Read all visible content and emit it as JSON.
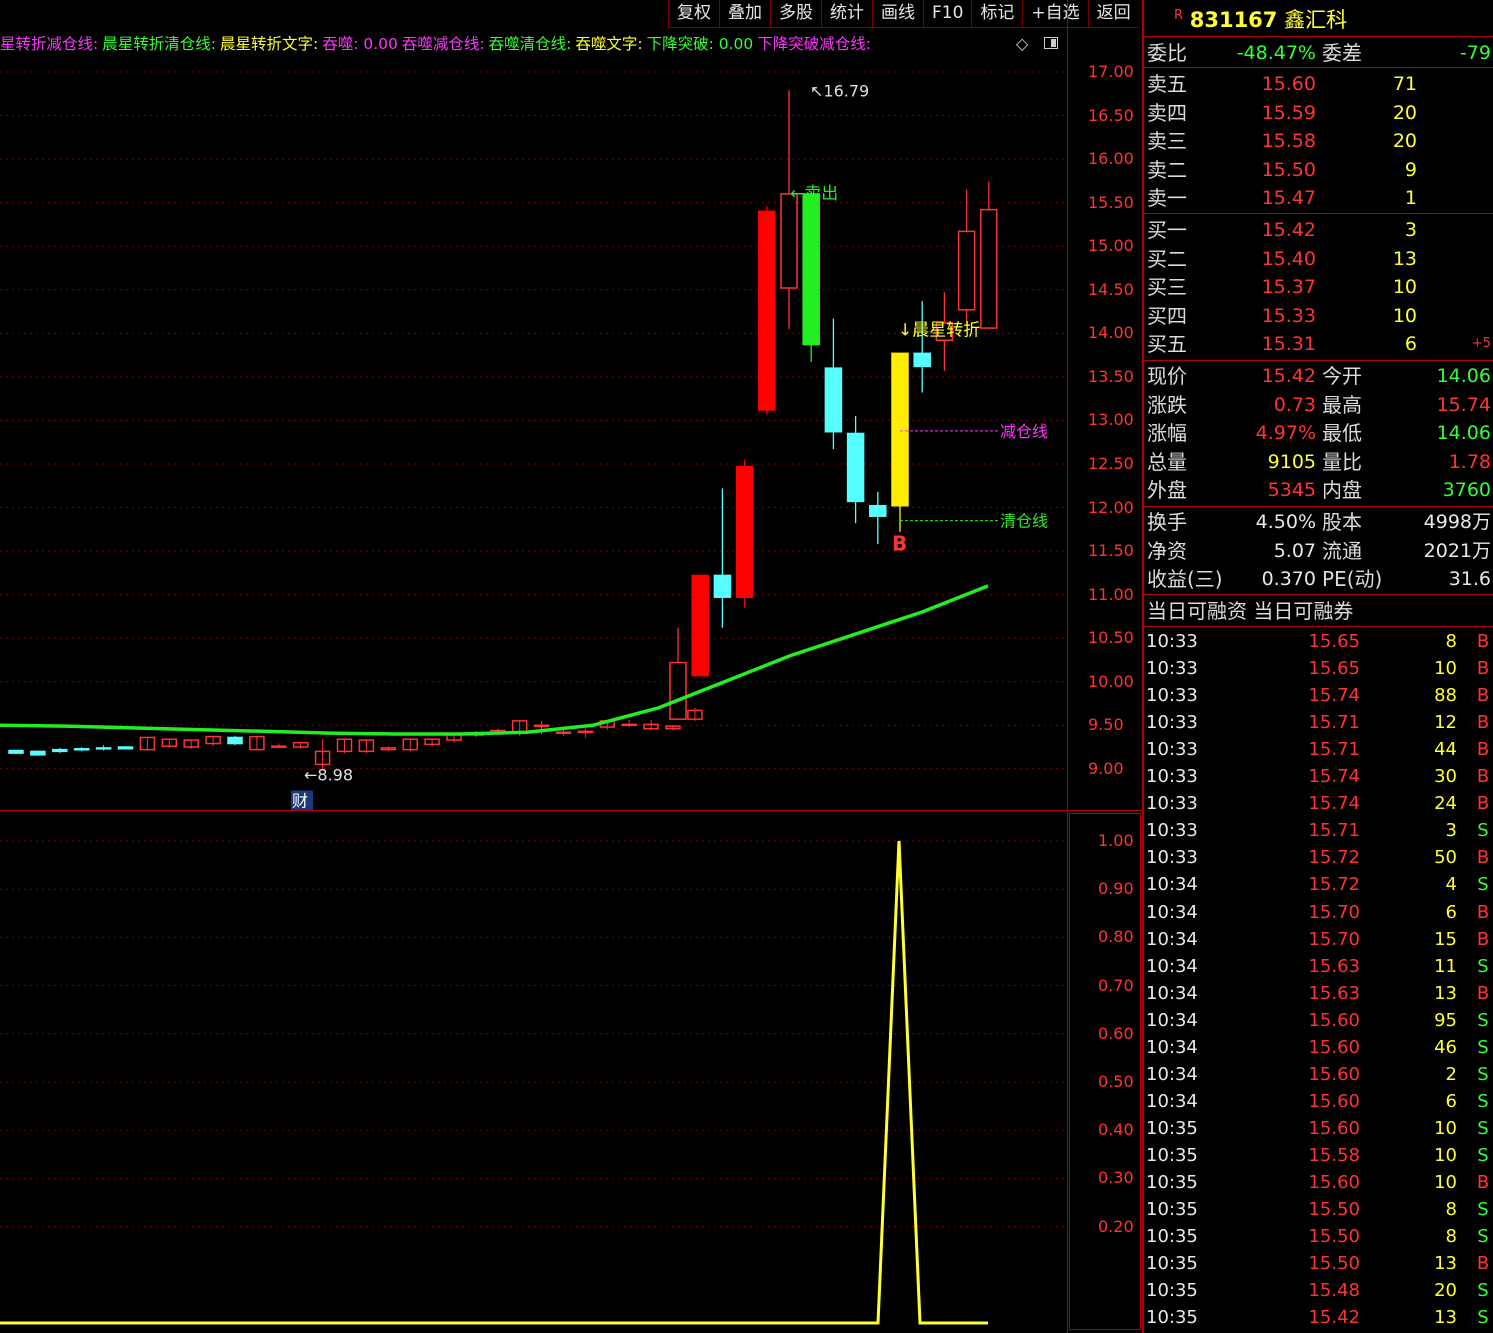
{
  "toolbar": [
    "复权",
    "叠加",
    "多股",
    "统计",
    "画线",
    "F10",
    "标记",
    "+自选",
    "返回"
  ],
  "indicator_line": [
    {
      "text": "星转折减仓线:",
      "color": "mag"
    },
    {
      "text": "晨星转折清仓线:",
      "color": "grn"
    },
    {
      "text": "晨星转折文字:",
      "color": "yel"
    },
    {
      "text": "吞噬: 0.00",
      "color": "mag"
    },
    {
      "text": "吞噬减仓线:",
      "color": "mag"
    },
    {
      "text": "吞噬清仓线:",
      "color": "grn"
    },
    {
      "text": "吞噬文字:",
      "color": "yel"
    },
    {
      "text": "下降突破: 0.00",
      "color": "grn"
    },
    {
      "text": "下降突破减仓线:",
      "color": "mag"
    }
  ],
  "chart_data": [
    {
      "type": "candlestick",
      "y_ticks": [
        17.0,
        16.5,
        16.0,
        15.5,
        15.0,
        14.5,
        14.0,
        13.5,
        13.0,
        12.5,
        12.0,
        11.5,
        11.0,
        10.5,
        10.0,
        9.5,
        9.0
      ],
      "ylim": [
        8.5,
        17.4
      ],
      "flat_candles": [
        [
          9.21,
          9.21,
          9.18,
          9.17
        ],
        [
          9.2,
          9.19,
          9.16,
          9.15
        ],
        [
          9.22,
          9.24,
          9.2,
          9.18
        ],
        [
          9.23,
          9.25,
          9.22,
          9.2
        ],
        [
          9.24,
          9.27,
          9.23,
          9.21
        ],
        [
          9.25,
          9.26,
          9.23,
          9.22
        ],
        [
          9.22,
          9.36,
          9.36,
          9.21
        ],
        [
          9.26,
          9.34,
          9.34,
          9.24
        ],
        [
          9.25,
          9.33,
          9.33,
          9.23
        ],
        [
          9.29,
          9.37,
          9.37,
          9.26
        ],
        [
          9.36,
          9.38,
          9.29,
          9.27
        ],
        [
          9.22,
          9.37,
          9.37,
          9.21
        ],
        [
          9.26,
          9.29,
          9.26,
          9.24
        ],
        [
          9.25,
          9.3,
          9.3,
          9.23
        ],
        [
          9.05,
          9.34,
          9.2,
          8.98
        ],
        [
          9.2,
          9.34,
          9.34,
          9.18
        ],
        [
          9.2,
          9.33,
          9.33,
          9.18
        ],
        [
          9.22,
          9.26,
          9.24,
          9.2
        ],
        [
          9.22,
          9.34,
          9.34,
          9.2
        ],
        [
          9.28,
          9.34,
          9.34,
          9.26
        ],
        [
          9.33,
          9.4,
          9.39,
          9.3
        ],
        [
          9.41,
          9.43,
          9.39,
          9.37
        ],
        [
          9.42,
          9.46,
          9.44,
          9.4
        ],
        [
          9.42,
          9.55,
          9.55,
          9.38
        ],
        [
          9.5,
          9.55,
          9.5,
          9.4
        ],
        [
          9.42,
          9.46,
          9.42,
          9.38
        ],
        [
          9.42,
          9.46,
          9.43,
          9.36
        ],
        [
          9.48,
          9.55,
          9.55,
          9.45
        ],
        [
          9.51,
          9.56,
          9.51,
          9.48
        ],
        [
          9.46,
          9.56,
          9.51,
          9.44
        ],
        [
          9.46,
          9.5,
          9.49,
          9.44
        ],
        [
          9.57,
          9.7,
          9.67,
          9.55
        ]
      ],
      "candles": [
        {
          "open": 9.57,
          "high": 10.62,
          "close": 10.22,
          "low": 9.57,
          "color": "red-hollow"
        },
        {
          "open": 10.07,
          "high": 11.22,
          "close": 11.22,
          "low": 10.07,
          "color": "red"
        },
        {
          "open": 11.22,
          "high": 12.22,
          "close": 10.97,
          "low": 10.62,
          "color": "cyan"
        },
        {
          "open": 10.97,
          "high": 12.55,
          "close": 12.47,
          "low": 10.85,
          "color": "red"
        },
        {
          "open": 13.12,
          "high": 15.46,
          "close": 15.4,
          "low": 13.07,
          "color": "red"
        },
        {
          "open": 14.52,
          "high": 16.79,
          "close": 15.6,
          "low": 14.05,
          "color": "red-hollow"
        },
        {
          "open": 15.6,
          "high": 15.62,
          "close": 13.87,
          "low": 13.67,
          "color": "green"
        },
        {
          "open": 13.6,
          "high": 14.17,
          "close": 12.87,
          "low": 12.67,
          "color": "cyan"
        },
        {
          "open": 12.85,
          "high": 13.05,
          "close": 12.07,
          "low": 11.82,
          "color": "cyan"
        },
        {
          "open": 12.02,
          "high": 12.18,
          "close": 11.9,
          "low": 11.58,
          "color": "cyan"
        },
        {
          "open": 12.02,
          "high": 13.77,
          "close": 13.77,
          "low": 11.72,
          "color": "yellow"
        },
        {
          "open": 13.77,
          "high": 14.37,
          "close": 13.62,
          "low": 13.32,
          "color": "cyan"
        },
        {
          "open": 13.92,
          "high": 14.47,
          "close": 14.12,
          "low": 13.57,
          "color": "red-hollow"
        },
        {
          "open": 14.27,
          "high": 15.65,
          "close": 15.17,
          "low": 14.1,
          "color": "red-hollow"
        },
        {
          "open": 14.06,
          "high": 15.74,
          "close": 15.42,
          "low": 14.06,
          "color": "red-hollow"
        }
      ],
      "ma_line": [
        9.5,
        9.49,
        9.47,
        9.45,
        9.43,
        9.41,
        9.4,
        9.4,
        9.42,
        9.5,
        9.7,
        10.0,
        10.3,
        10.55,
        10.8,
        11.1
      ],
      "annotations": {
        "high_label": "16.79",
        "low_label": "8.98",
        "sell_label": "卖出",
        "morning_star_label": "↓晨星转折",
        "reduce_label": "减仓线",
        "clear_label": "清仓线",
        "buy_label": "B",
        "fin_label": "财",
        "reduce_price": 12.88,
        "clear_price": 11.85
      }
    },
    {
      "type": "line",
      "y_ticks": [
        1.0,
        0.9,
        0.8,
        0.7,
        0.6,
        0.5,
        0.4,
        0.3,
        0.2
      ],
      "ylim": [
        0.0,
        1.04
      ],
      "values": [
        0,
        0,
        1,
        0,
        0
      ],
      "color": "#ffff33"
    }
  ],
  "title": {
    "code": "831167",
    "name": "鑫汇科",
    "mark": "R"
  },
  "weibi": {
    "label1": "委比",
    "value1": "-48.47%",
    "label2": "委差",
    "value2": "-79"
  },
  "sells": [
    {
      "label": "卖五",
      "price": "15.60",
      "vol": "71"
    },
    {
      "label": "卖四",
      "price": "15.59",
      "vol": "20"
    },
    {
      "label": "卖三",
      "price": "15.58",
      "vol": "20"
    },
    {
      "label": "卖二",
      "price": "15.50",
      "vol": "9"
    },
    {
      "label": "卖一",
      "price": "15.47",
      "vol": "1"
    }
  ],
  "buys": [
    {
      "label": "买一",
      "price": "15.42",
      "vol": "3",
      "extra": ""
    },
    {
      "label": "买二",
      "price": "15.40",
      "vol": "13",
      "extra": ""
    },
    {
      "label": "买三",
      "price": "15.37",
      "vol": "10",
      "extra": ""
    },
    {
      "label": "买四",
      "price": "15.33",
      "vol": "10",
      "extra": ""
    },
    {
      "label": "买五",
      "price": "15.31",
      "vol": "6",
      "extra": "+5"
    }
  ],
  "quote": [
    {
      "l1": "现价",
      "v1": "15.42",
      "c1": "red",
      "l2": "今开",
      "v2": "14.06",
      "c2": "green"
    },
    {
      "l1": "涨跌",
      "v1": "0.73",
      "c1": "red",
      "l2": "最高",
      "v2": "15.74",
      "c2": "red"
    },
    {
      "l1": "涨幅",
      "v1": "4.97%",
      "c1": "red",
      "l2": "最低",
      "v2": "14.06",
      "c2": "green"
    },
    {
      "l1": "总量",
      "v1": "9105",
      "c1": "yellow",
      "l2": "量比",
      "v2": "1.78",
      "c2": "red"
    },
    {
      "l1": "外盘",
      "v1": "5345",
      "c1": "red",
      "l2": "内盘",
      "v2": "3760",
      "c2": "green"
    }
  ],
  "fund": [
    {
      "l1": "换手",
      "v1": "4.50%",
      "l2": "股本",
      "v2": "4998万"
    },
    {
      "l1": "净资",
      "v1": "5.07",
      "l2": "流通",
      "v2": "2021万"
    },
    {
      "l1": "收益(三)",
      "v1": "0.370",
      "l2": "PE(动)",
      "v2": "31.6"
    }
  ],
  "margin_row": "当日可融资 当日可融券",
  "ticks": [
    {
      "t": "10:33",
      "p": "15.65",
      "v": "8",
      "f": "B"
    },
    {
      "t": "10:33",
      "p": "15.65",
      "v": "10",
      "f": "B"
    },
    {
      "t": "10:33",
      "p": "15.74",
      "v": "88",
      "f": "B"
    },
    {
      "t": "10:33",
      "p": "15.71",
      "v": "12",
      "f": "B"
    },
    {
      "t": "10:33",
      "p": "15.71",
      "v": "44",
      "f": "B"
    },
    {
      "t": "10:33",
      "p": "15.74",
      "v": "30",
      "f": "B"
    },
    {
      "t": "10:33",
      "p": "15.74",
      "v": "24",
      "f": "B"
    },
    {
      "t": "10:33",
      "p": "15.71",
      "v": "3",
      "f": "S"
    },
    {
      "t": "10:33",
      "p": "15.72",
      "v": "50",
      "f": "B"
    },
    {
      "t": "10:34",
      "p": "15.72",
      "v": "4",
      "f": "S"
    },
    {
      "t": "10:34",
      "p": "15.70",
      "v": "6",
      "f": "B"
    },
    {
      "t": "10:34",
      "p": "15.70",
      "v": "15",
      "f": "B"
    },
    {
      "t": "10:34",
      "p": "15.63",
      "v": "11",
      "f": "S"
    },
    {
      "t": "10:34",
      "p": "15.63",
      "v": "13",
      "f": "B"
    },
    {
      "t": "10:34",
      "p": "15.60",
      "v": "95",
      "f": "S"
    },
    {
      "t": "10:34",
      "p": "15.60",
      "v": "46",
      "f": "S"
    },
    {
      "t": "10:34",
      "p": "15.60",
      "v": "2",
      "f": "S"
    },
    {
      "t": "10:34",
      "p": "15.60",
      "v": "6",
      "f": "S"
    },
    {
      "t": "10:35",
      "p": "15.60",
      "v": "10",
      "f": "S"
    },
    {
      "t": "10:35",
      "p": "15.58",
      "v": "10",
      "f": "S"
    },
    {
      "t": "10:35",
      "p": "15.60",
      "v": "10",
      "f": "B"
    },
    {
      "t": "10:35",
      "p": "15.50",
      "v": "8",
      "f": "S"
    },
    {
      "t": "10:35",
      "p": "15.50",
      "v": "8",
      "f": "S"
    },
    {
      "t": "10:35",
      "p": "15.50",
      "v": "13",
      "f": "B"
    },
    {
      "t": "10:35",
      "p": "15.48",
      "v": "20",
      "f": "S"
    },
    {
      "t": "10:35",
      "p": "15.42",
      "v": "13",
      "f": "S"
    }
  ]
}
